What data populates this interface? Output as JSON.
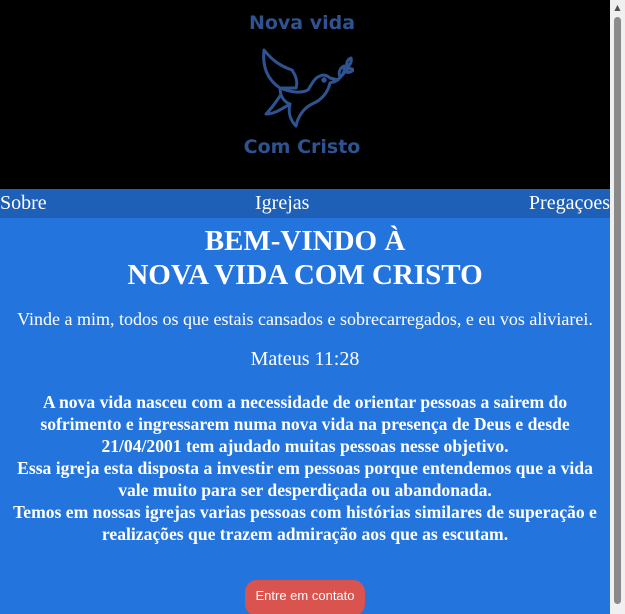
{
  "logo": {
    "top_text": "Nova vida",
    "bottom_text": "Com Cristo"
  },
  "nav": {
    "items": [
      {
        "label": "Sobre"
      },
      {
        "label": "Igrejas"
      },
      {
        "label": "Pregaçoes"
      }
    ]
  },
  "main": {
    "title_line1": "BEM-VINDO À",
    "title_line2": "NOVA VIDA COM CRISTO",
    "verse": "Vinde a mim, todos os que estais cansados e sobrecarregados, e eu vos aliviarei.",
    "verse_ref": "Mateus 11:28",
    "about_paragraphs": [
      "A nova vida nasceu com a necessidade de orientar pessoas a sairem do sofrimento e ingressarem numa nova vida na presença de Deus e desde 21/04/2001 tem ajudado muitas pessoas nesse objetivo.",
      "Essa igreja esta disposta a investir em pessoas porque entendemos que a vida vale muito para ser desperdiçada ou abandonada.",
      "Temos em nossas igrejas varias pessoas com histórias similares de superação e realizações que trazem admiração aos que as escutam."
    ],
    "contact_button": "Entre em contato"
  },
  "colors": {
    "header_bg": "#000000",
    "logo": "#2f5390",
    "nav_bg": "#1e5fb8",
    "main_bg": "#2474dd",
    "button_bg": "#d9534f"
  },
  "icons": {
    "logo": "dove-with-olive-branch-icon",
    "scroll_up": "scroll-up-arrow-icon"
  }
}
